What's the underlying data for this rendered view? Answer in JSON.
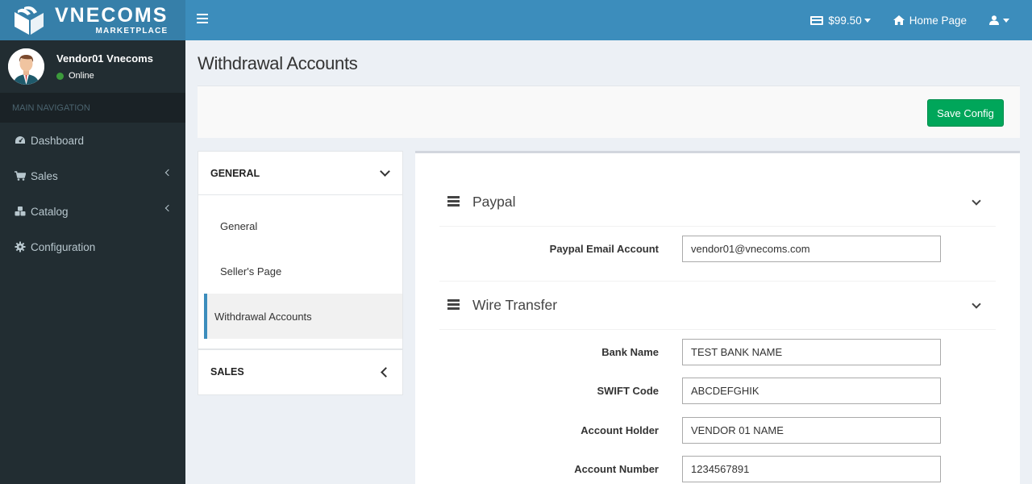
{
  "brand": {
    "name": "VNECOMS",
    "tagline": "MARKETPLACE"
  },
  "topbar": {
    "balance": "$99.50",
    "home_label": "Home Page",
    "icons": {
      "toggle": "hamburger-icon",
      "balance": "credit-card-icon",
      "home": "home-icon",
      "user": "user-icon"
    }
  },
  "user": {
    "name": "Vendor01 Vnecoms",
    "status": "Online",
    "status_color": "#3c9a3c"
  },
  "sidebar": {
    "header": "MAIN NAVIGATION",
    "items": [
      {
        "label": "Dashboard",
        "icon": "dashboard-icon",
        "has_children": false
      },
      {
        "label": "Sales",
        "icon": "cart-icon",
        "has_children": true
      },
      {
        "label": "Catalog",
        "icon": "cubes-icon",
        "has_children": true
      },
      {
        "label": "Configuration",
        "icon": "gear-icon",
        "has_children": false
      }
    ]
  },
  "page": {
    "title": "Withdrawal Accounts",
    "save_label": "Save Config"
  },
  "config_nav": {
    "groups": [
      {
        "label": "GENERAL",
        "expanded": true,
        "items": [
          {
            "label": "General",
            "active": false
          },
          {
            "label": "Seller's Page",
            "active": false
          },
          {
            "label": "Withdrawal Accounts",
            "active": true
          }
        ]
      },
      {
        "label": "SALES",
        "expanded": false,
        "items": []
      }
    ]
  },
  "sections": {
    "paypal": {
      "title": "Paypal",
      "fields": [
        {
          "label": "Paypal Email Account",
          "value": "vendor01@vnecoms.com"
        }
      ]
    },
    "wire": {
      "title": "Wire Transfer",
      "fields": [
        {
          "label": "Bank Name",
          "value": "TEST BANK NAME"
        },
        {
          "label": "SWIFT Code",
          "value": "ABCDEFGHIK"
        },
        {
          "label": "Account Holder",
          "value": "VENDOR 01 NAME"
        },
        {
          "label": "Account Number",
          "value": "1234567891"
        }
      ]
    }
  },
  "colors": {
    "header": "#3c8dbc",
    "logo_bg": "#367fa9",
    "sidebar": "#222d32",
    "save_button": "#00a65a"
  }
}
